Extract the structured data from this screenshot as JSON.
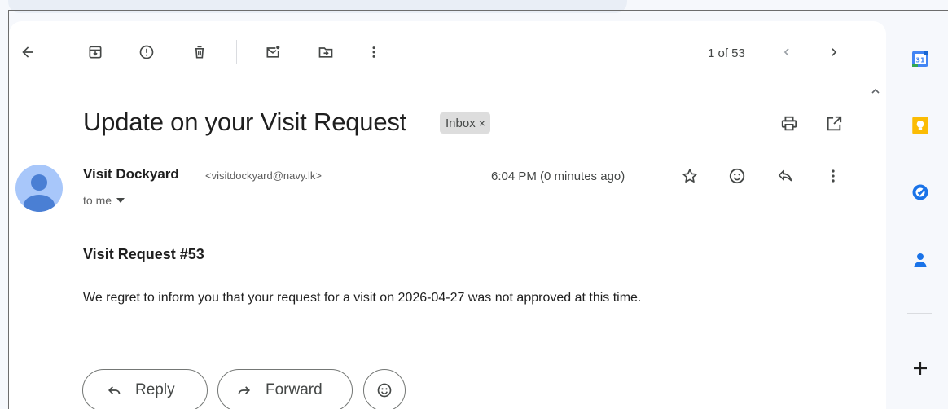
{
  "toolbar": {
    "back_icon": "arrow-left-icon",
    "archive_icon": "archive-icon",
    "spam_icon": "report-spam-icon",
    "delete_icon": "trash-icon",
    "unread_icon": "mark-unread-icon",
    "move_icon": "move-to-folder-icon",
    "more_icon": "more-vert-icon",
    "pager": "1 of 53"
  },
  "email": {
    "subject": "Update on your Visit Request",
    "label_chip": "Inbox",
    "label_chip_close": "×",
    "sender_name": "Visit Dockyard",
    "sender_email": "<visitdockyard@navy.lk>",
    "recipient": "to me",
    "time": "6:04 PM (0 minutes ago)",
    "body_heading": "Visit Request #53",
    "body_text": "We regret to inform you that your request for a visit on 2026-04-27 was not approved at this time."
  },
  "actions": {
    "reply_label": "Reply",
    "forward_label": "Forward"
  },
  "side_panel": {
    "calendar_day": "31"
  },
  "colors": {
    "calendar_blue": "#4285f4",
    "keep_yellow": "#fbbc04",
    "tasks_blue": "#1a73e8",
    "contacts_blue": "#1a73e8",
    "avatar_bg": "#a8c7fa",
    "avatar_fg": "#4a7fd4"
  }
}
